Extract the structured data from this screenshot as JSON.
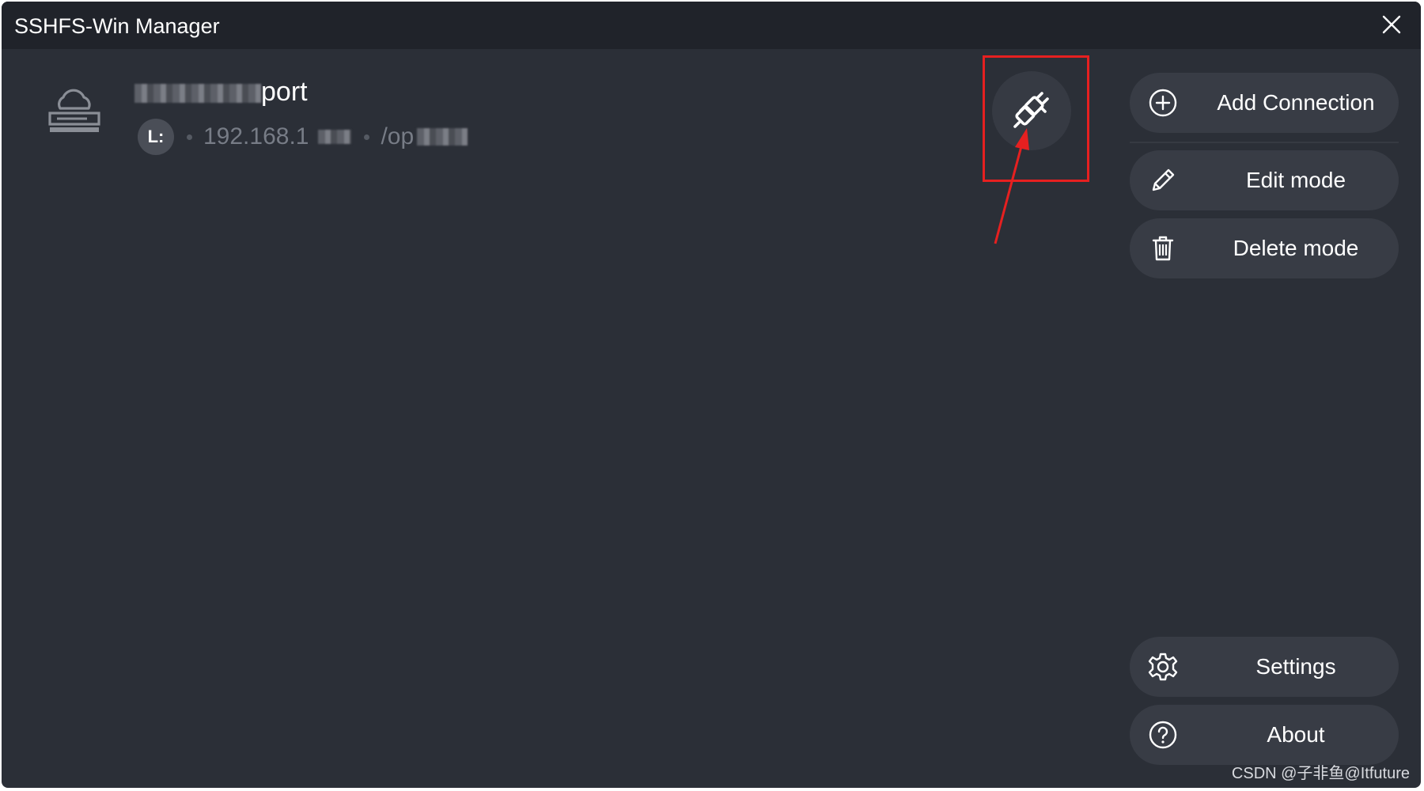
{
  "window": {
    "title": "SSHFS-Win Manager"
  },
  "connection": {
    "name_visible": "port",
    "drive_letter": "L:",
    "host_visible": "192.168.1",
    "path_visible": "/op"
  },
  "sidebar": {
    "top_buttons": [
      {
        "label": "Add Connection",
        "icon": "plus-circle-icon"
      },
      {
        "label": "Edit mode",
        "icon": "pencil-icon"
      },
      {
        "label": "Delete mode",
        "icon": "trash-icon"
      }
    ],
    "bottom_buttons": [
      {
        "label": "Settings",
        "icon": "gear-icon"
      },
      {
        "label": "About",
        "icon": "help-circle-icon"
      }
    ]
  },
  "annotation": {
    "highlight_color": "#e62020"
  },
  "watermark": "CSDN @子非鱼@Itfuture",
  "colors": {
    "background": "#2b2f37",
    "titlebar": "#20232a",
    "button": "#383c45",
    "text": "#ffffff",
    "muted_text": "#777c86"
  }
}
